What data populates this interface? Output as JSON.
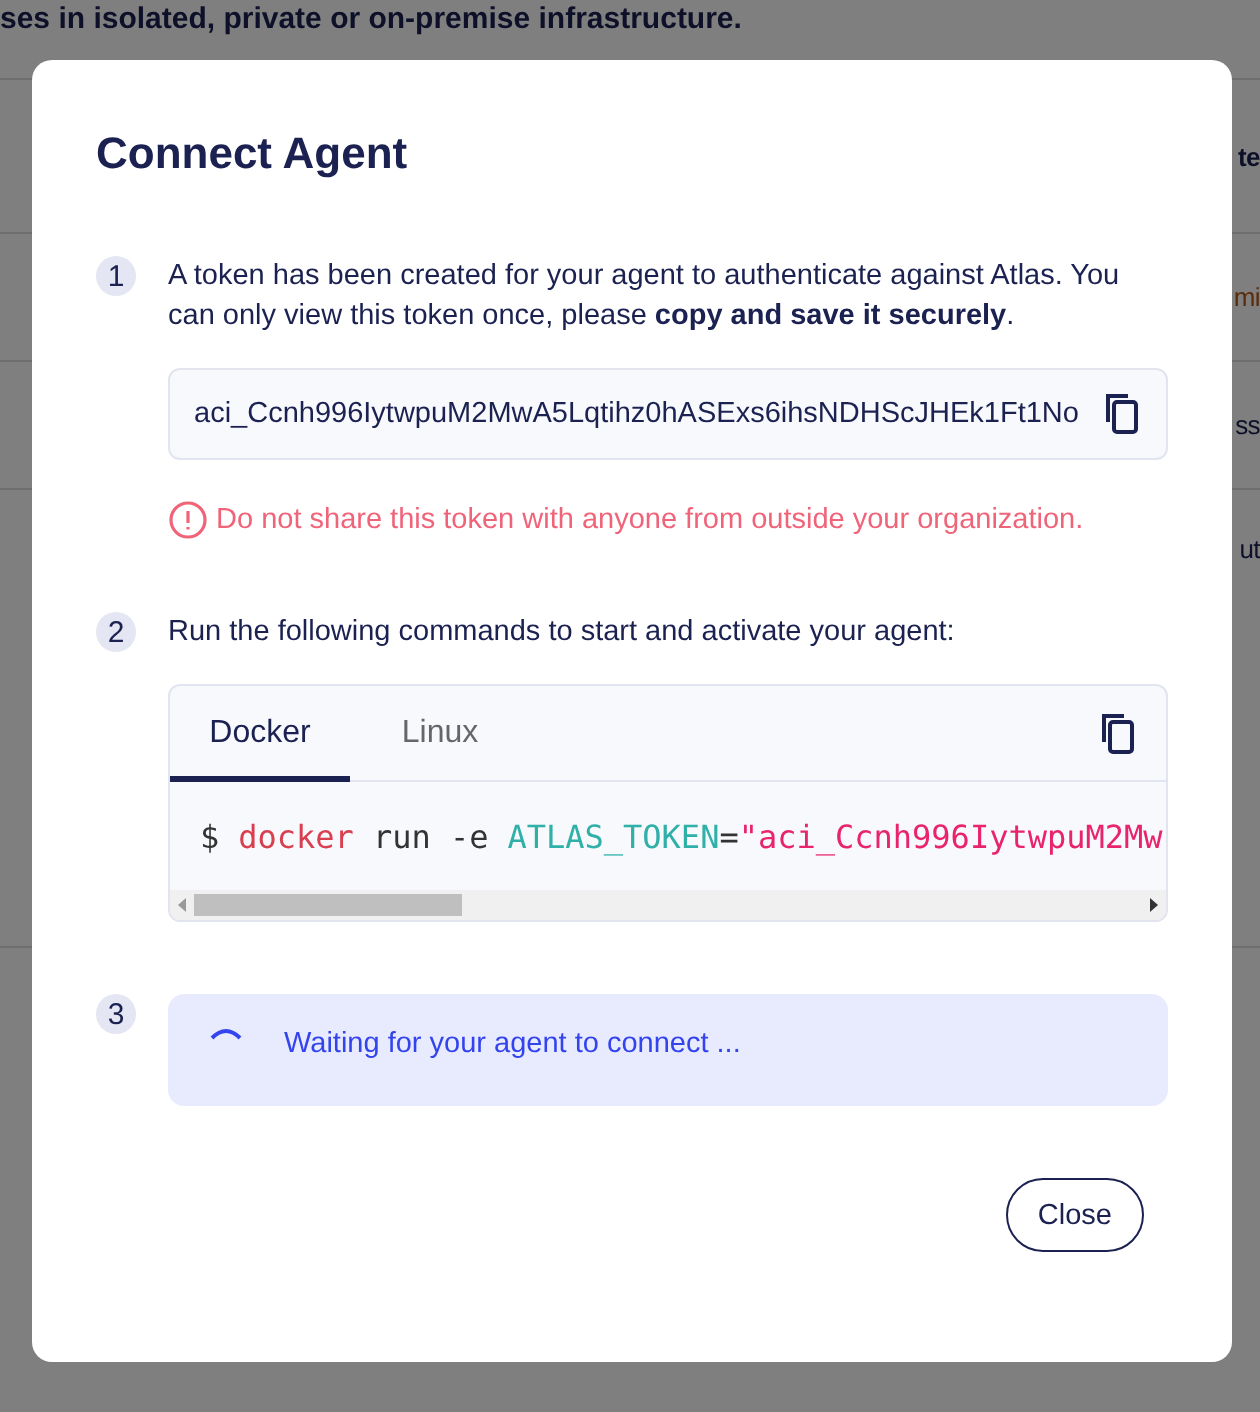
{
  "background": {
    "header": "ses in isolated, private or on-premise infrastructure.",
    "row_fragments": [
      "te",
      "mi",
      "ss",
      "ut"
    ]
  },
  "dialog": {
    "title": "Connect Agent",
    "steps": [
      {
        "number": "1",
        "kind": "token",
        "text": "A token has been created for your agent to authenticate against Atlas. You can only view this token once, please **copy and save it securely**.",
        "token": "aci_Ccnh996IytwpuM2MwA5Lqtihz0hASExs6ihsNDHScJHEk1Ft1No",
        "warning": "Do not share this token with anyone from outside your organization."
      },
      {
        "number": "2",
        "kind": "commands",
        "text": "Run the following commands to start and activate your agent:",
        "tabs": [
          {
            "label": "Docker",
            "selected": true
          },
          {
            "label": "Linux",
            "selected": false
          }
        ],
        "code": [
          {
            "kind": "prompt",
            "text": "$"
          },
          {
            "kind": "command",
            "text": "docker"
          },
          {
            "kind": "plain",
            "text": "run -e"
          },
          {
            "kind": "variable",
            "text": "ATLAS_TOKEN"
          },
          {
            "kind": "operator",
            "text": "="
          },
          {
            "kind": "string",
            "text": "\"aci_Ccnh996IytwpuM2Mw"
          }
        ]
      },
      {
        "number": "3",
        "kind": "status",
        "text": "Waiting for your agent to connect ..."
      }
    ],
    "buttons": [
      "Close"
    ]
  }
}
